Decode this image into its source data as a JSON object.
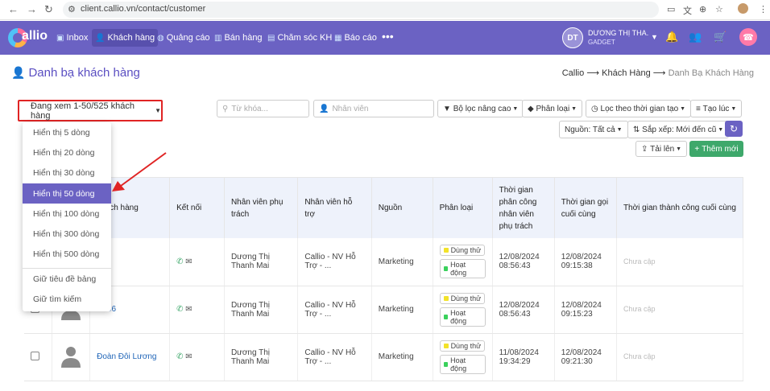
{
  "browser": {
    "url": "client.callio.vn/contact/customer"
  },
  "brand": {
    "name": "allio",
    "accent": "#6b62c3"
  },
  "nav": [
    {
      "label": "Inbox",
      "icon": "inbox-icon",
      "active": false
    },
    {
      "label": "Khách hàng",
      "icon": "users-icon",
      "active": true
    },
    {
      "label": "Quảng cáo",
      "icon": "globe-icon",
      "active": false
    },
    {
      "label": "Bán hàng",
      "icon": "chart-icon",
      "active": false
    },
    {
      "label": "Chăm sóc KH",
      "icon": "support-icon",
      "active": false
    },
    {
      "label": "Báo cáo",
      "icon": "report-icon",
      "active": false
    }
  ],
  "user": {
    "initials": "DT",
    "name": "DƯƠNG THỊ THA...",
    "company": "GADGET"
  },
  "page": {
    "title": "Danh bạ khách hàng"
  },
  "breadcrumb": [
    "Callio",
    "Khách Hàng",
    "Danh Bạ Khách Hàng"
  ],
  "toolbar": {
    "view_count": "Đang xem 1-50/525 khách hàng",
    "keyword_placeholder": "Từ khóa...",
    "staff_placeholder": "Nhân viên",
    "advanced_filter": "Bộ lọc nâng cao",
    "category": "Phân loại",
    "created_filter": "Lọc theo thời gian tạo",
    "created_at": "Tạo lúc",
    "source": "Nguồn: Tất cả",
    "sort": "Sắp xếp: Mới đến cũ",
    "upload": "Tải lên",
    "add_new": "Thêm mới"
  },
  "dropdown": {
    "items": [
      "Hiển thị 5 dòng",
      "Hiển thị 20 dòng",
      "Hiển thị 30 dòng",
      "Hiển thị 50 dòng",
      "Hiển thị 100 dòng",
      "Hiển thị 300 dòng",
      "Hiển thị 500 dòng",
      "Giữ tiêu đề bảng",
      "Giữ tìm kiếm"
    ],
    "selected": "Hiển thị 50 dòng"
  },
  "table": {
    "headers": {
      "name": "khách hàng",
      "connect": "Kết nối",
      "staff": "Nhân viên phụ trách",
      "support": "Nhân viên hỗ trợ",
      "source": "Nguồn",
      "category": "Phân loại",
      "assigned": "Thời gian phân công nhân viên phụ trách",
      "last_call": "Thời gian gọi cuối cùng",
      "last_success": "Thời gian thành công cuối cùng"
    },
    "rows": [
      {
        "name": "n",
        "staff": "Dương Thị Thanh Mai",
        "support": "Callio - NV Hỗ Trợ - ...",
        "source": "Marketing",
        "tags": [
          "Dùng thử",
          "Hoạt động"
        ],
        "assigned_date": "12/08/2024",
        "assigned_time": "08:56:43",
        "call_date": "12/08/2024",
        "call_time": "09:15:38",
        "success": "Chưa cập"
      },
      {
        "name": "Hà56",
        "staff": "Dương Thị Thanh Mai",
        "support": "Callio - NV Hỗ Trợ - ...",
        "source": "Marketing",
        "tags": [
          "Dùng thử",
          "Hoạt động"
        ],
        "assigned_date": "12/08/2024",
        "assigned_time": "08:56:43",
        "call_date": "12/08/2024",
        "call_time": "09:15:23",
        "success": "Chưa cập"
      },
      {
        "name": "Đoàn Đôi Lương",
        "staff": "Dương Thị Thanh Mai",
        "support": "Callio - NV Hỗ Trợ - ...",
        "source": "Marketing",
        "tags": [
          "Dùng thử",
          "Hoạt động"
        ],
        "assigned_date": "11/08/2024",
        "assigned_time": "19:34:29",
        "call_date": "12/08/2024",
        "call_time": "09:21:30",
        "success": "Chưa cập"
      }
    ]
  },
  "colors": {
    "tag_trial": "#f2e22a",
    "tag_active": "#3ad15c",
    "highlight": "#e02424"
  }
}
